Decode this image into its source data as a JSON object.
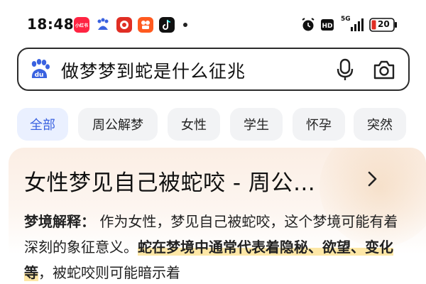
{
  "status_bar": {
    "time": "18:48",
    "network": "5G",
    "battery": "20",
    "apps": [
      {
        "name": "xiaohongshu-icon",
        "color": "#ff2442",
        "label": "小红书"
      },
      {
        "name": "baidu-icon",
        "color": "#3a62e0",
        "label": ""
      },
      {
        "name": "pdd-icon",
        "color": "#e02e24",
        "label": ""
      },
      {
        "name": "kuaishou-icon",
        "color": "#ff5a1f",
        "label": ""
      },
      {
        "name": "tiktok-icon",
        "color": "#111111",
        "label": ""
      }
    ]
  },
  "search": {
    "query": "做梦梦到蛇是什么征兆"
  },
  "tabs": [
    {
      "label": "全部",
      "active": true
    },
    {
      "label": "周公解梦",
      "active": false
    },
    {
      "label": "女性",
      "active": false
    },
    {
      "label": "学生",
      "active": false
    },
    {
      "label": "怀孕",
      "active": false
    },
    {
      "label": "突然",
      "active": false
    }
  ],
  "result": {
    "title": "女性梦见自己被蛇咬 - 周公…",
    "label": "梦境解释：",
    "text_1": " 作为女性，梦见自己被蛇咬，这个梦境可能有着深刻的象征意义。",
    "highlight": "蛇在梦境中通常代表着隐秘、欲望、变化等",
    "text_2": "，被蛇咬则可能暗示着"
  },
  "colors": {
    "accent": "#3a62e0",
    "highlight": "#fde7a6"
  }
}
